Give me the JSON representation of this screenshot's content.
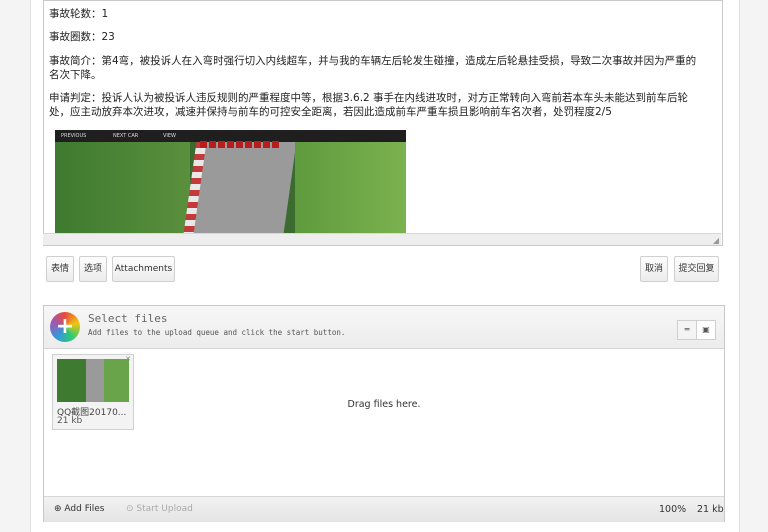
{
  "editor": {
    "line_rounds": "事故轮数：1",
    "line_laps": "事故圈数：23",
    "line_summary": "事故简介：第4弯，被投诉人在入弯时强行切入内线超车，并与我的车辆左后轮发生碰撞，造成左后轮悬挂受损，导致二次事故并因为严重的名次下降。",
    "line_judgement": "申请判定：投诉人认为被投诉人违反规则的严重程度中等，根据3.6.2 事手在内线进攻时，对方正常转向入弯前若本车头未能达到前车后轮处，应主动放弃本次进攻，减速并保持与前车的可控安全距离，若因此造成前车严重车损且影响前车名次者，处罚程度2/5",
    "image_top_buttons": [
      "PREVIOUS",
      "NEXT CAR",
      "VIEW"
    ]
  },
  "toolbar": {
    "emoji_label": "表情",
    "options_label": "选项",
    "attachments_label": "Attachments",
    "cancel_label": "取消",
    "submit_label": "提交回复"
  },
  "uploader": {
    "title": "Select files",
    "subtitle": "Add files to the upload queue and click the start button.",
    "drag_text": "Drag files here.",
    "file": {
      "name": "QQ截图20170...",
      "size": "21 kb"
    },
    "add_files_label": "Add Files",
    "start_upload_label": "Start Upload",
    "percent": "100%",
    "total_size": "21 kb"
  },
  "colors": {
    "scroll_accent": "#cc0000"
  }
}
